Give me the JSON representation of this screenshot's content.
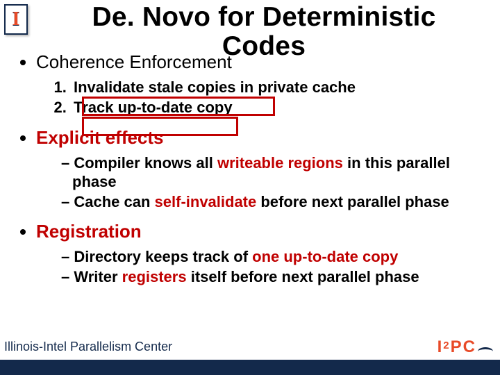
{
  "logos": {
    "illinois_letter": "I",
    "i2pc": {
      "i1": "I",
      "two": "2",
      "p": "P",
      "c": "C"
    }
  },
  "title": "De. Novo for Deterministic Codes",
  "bullets": {
    "coherence": {
      "head": "Coherence Enforcement",
      "items": [
        "Invalidate stale copies in private cache",
        "Track up-to-date copy"
      ]
    },
    "effects": {
      "head": "Explicit effects",
      "items": [
        {
          "pre": "Compiler knows all ",
          "em": "writeable regions",
          "post": " in this parallel phase"
        },
        {
          "pre": "Cache can ",
          "em": "self-invalidate",
          "post": " before next parallel phase"
        }
      ]
    },
    "registration": {
      "head": "Registration",
      "items": [
        {
          "pre": "Directory keeps track of ",
          "em": "one up-to-date copy",
          "post": ""
        },
        {
          "pre": "Writer ",
          "em": "registers",
          "post": " itself before next parallel phase"
        }
      ]
    }
  },
  "footer": "Illinois-Intel Parallelism Center"
}
